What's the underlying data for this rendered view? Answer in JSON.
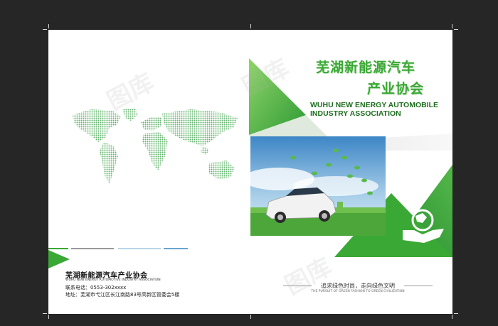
{
  "back_cover": {
    "org_name": "芜湖新能源汽车产业协会",
    "org_name_en": "WUHU NEW ENERGY AUTOMOTIVE INDUSTRY ASSOCIATION",
    "phone": "联系电话：0553-302xxxx",
    "address": "地址：芜湖市弋江区长江南路83号高新区管委会5楼"
  },
  "front_cover": {
    "title_line1": "芜湖新能源汽车",
    "title_line2": "产业协会",
    "title_en_line1": "WUHU NEW ENERGY AUTOMOBILE",
    "title_en_line2": "INDUSTRY ASSOCIATION",
    "slogan": "追求绿色时尚，走向绿色文明",
    "slogan_en": "THE PURSUIT OF GREEN FASHION TO GREEN CIVILIZATION",
    "logo_icon": "globe-in-hand-icon"
  },
  "watermark_text": "图库",
  "colors": {
    "green": "#3aa835",
    "dark_green": "#1e6e1f",
    "light_green": "#7fcf5a",
    "background": "#262626",
    "paper": "#ffffff"
  }
}
